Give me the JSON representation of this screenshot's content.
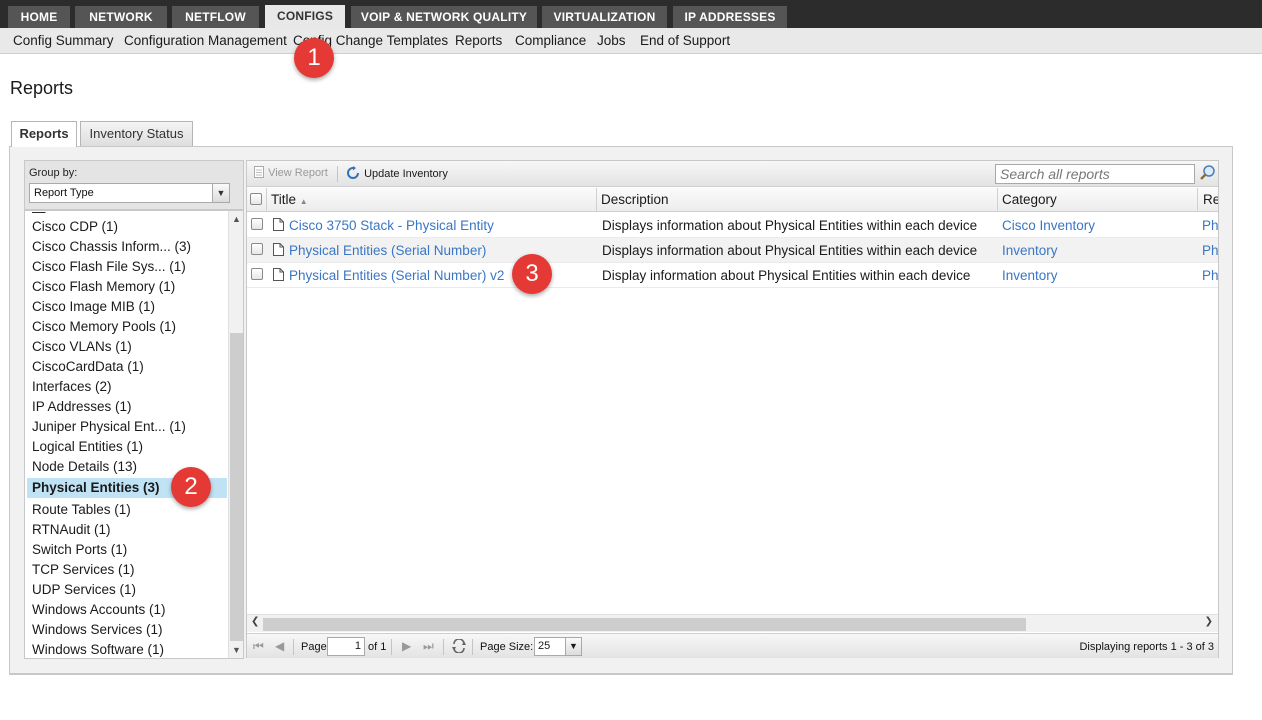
{
  "topnav": {
    "tabs": [
      {
        "label": "HOME"
      },
      {
        "label": "NETWORK"
      },
      {
        "label": "NETFLOW"
      },
      {
        "label": "CONFIGS",
        "active": true
      },
      {
        "label": "VOIP & NETWORK QUALITY"
      },
      {
        "label": "VIRTUALIZATION"
      },
      {
        "label": "IP ADDRESSES"
      }
    ]
  },
  "subnav": {
    "items": [
      "Config Summary",
      "Configuration Management",
      "Config Change Templates",
      "Reports",
      "Compliance",
      "Jobs",
      "End of Support"
    ]
  },
  "page": {
    "title": "Reports",
    "tabs": [
      {
        "label": "Reports",
        "active": true
      },
      {
        "label": "Inventory Status"
      }
    ]
  },
  "group_panel": {
    "label": "Group by:",
    "selected": "Report Type",
    "items": [
      "Cisco CDP (1)",
      "Cisco Chassis Inform... (3)",
      "Cisco Flash File Sys... (1)",
      "Cisco Flash Memory (1)",
      "Cisco Image MIB (1)",
      "Cisco Memory Pools (1)",
      "Cisco VLANs (1)",
      "CiscoCardData (1)",
      "Interfaces (2)",
      "IP Addresses (1)",
      "Juniper Physical Ent... (1)",
      "Logical Entities (1)",
      "Node Details (13)",
      "Physical Entities (3)",
      "Route Tables (1)",
      "RTNAudit (1)",
      "Switch Ports (1)",
      "TCP Services (1)",
      "UDP Services (1)",
      "Windows Accounts (1)",
      "Windows Services (1)",
      "Windows Software (1)"
    ],
    "selected_item": "Physical Entities (3)"
  },
  "toolbar": {
    "view_report": "View Report",
    "update_inventory": "Update Inventory",
    "search_placeholder": "Search all reports"
  },
  "table": {
    "columns": [
      "Title",
      "Description",
      "Category",
      "Re"
    ],
    "rows": [
      {
        "title": "Cisco 3750 Stack - Physical Entity",
        "description": "Displays information about Physical Entities within each device",
        "category": "Cisco Inventory",
        "re": "Ph"
      },
      {
        "title": "Physical Entities (Serial Number)",
        "description": "Displays information about Physical Entities within each device",
        "category": "Inventory",
        "re": "Ph"
      },
      {
        "title": "Physical Entities (Serial Number) v2",
        "description": "Display information about Physical Entities within each device",
        "category": "Inventory",
        "re": "Ph"
      }
    ]
  },
  "pager": {
    "page_label": "Page",
    "page_value": "1",
    "of_label": "of 1",
    "page_size_label": "Page Size:",
    "page_size_value": "25",
    "status": "Displaying reports 1 - 3 of 3"
  },
  "markers": [
    "1",
    "2",
    "3"
  ],
  "colors": {
    "topnav_bg": "#2c2c2c",
    "link": "#3a76c4",
    "selection": "#bfe3f5",
    "marker": "#e53935"
  }
}
